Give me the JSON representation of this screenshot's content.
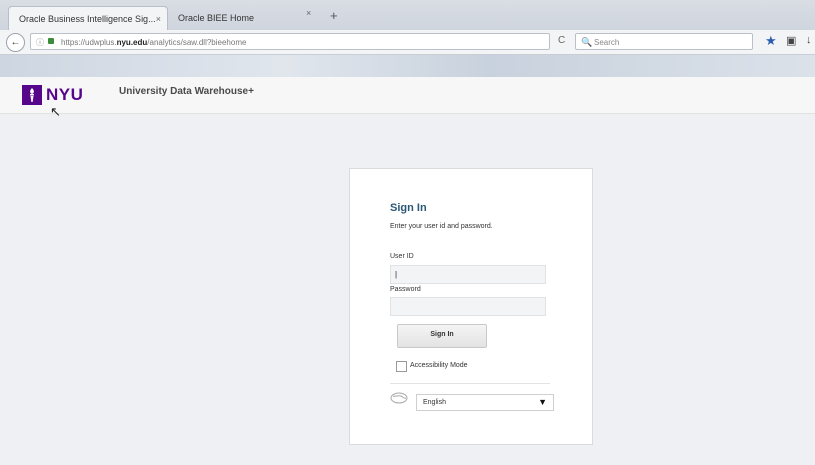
{
  "browser": {
    "tabs": [
      {
        "title": "Oracle Business Intelligence Sig...",
        "close": "×"
      },
      {
        "title": "Oracle BIEE Home",
        "close": "×"
      }
    ],
    "new_tab": "+",
    "back": "←",
    "url_prefix": "https://udwplus.",
    "url_domain": "nyu.edu",
    "url_suffix": "/analytics/saw.dll?bieehome",
    "search_placeholder": "Search",
    "icons": {
      "info": "ⓘ",
      "reload": "C",
      "search": "🔍",
      "star": "★",
      "clipboard": "▣",
      "download": "↓"
    }
  },
  "header": {
    "logo_mark": "🔥",
    "logo_text": "NYU",
    "app_title": "University Data Warehouse+",
    "cursor": "↖"
  },
  "signin": {
    "title": "Sign In",
    "instructions": "Enter your user id and password.",
    "user_label": "User ID",
    "user_value": "|",
    "password_label": "Password",
    "button_label": "Sign In",
    "accessibility_label": "Accessibility Mode",
    "language": "English",
    "language_caret": "▼",
    "globe": "🌐"
  },
  "colors": {
    "nyu_purple": "#57068c",
    "signin_title": "#2b5877",
    "page_bg": "#eef0f3"
  }
}
